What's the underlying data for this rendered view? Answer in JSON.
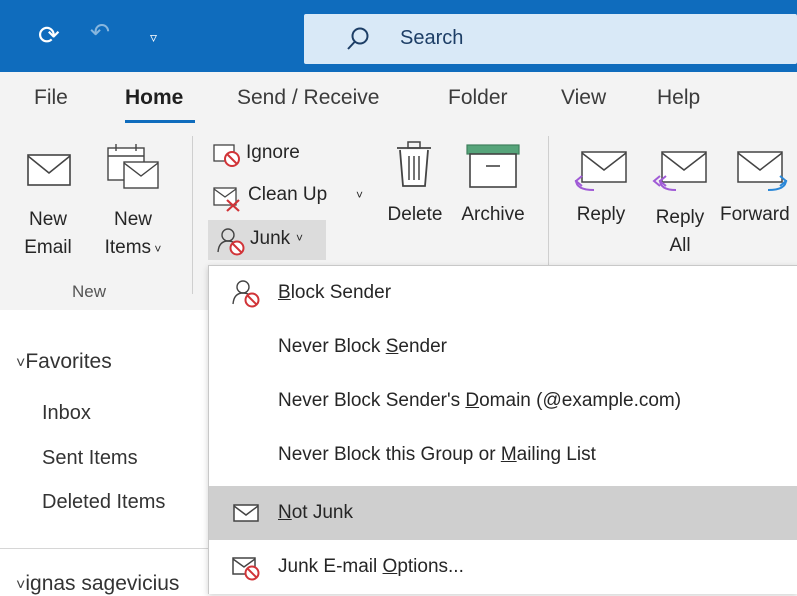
{
  "quick_access": {
    "search_placeholder": "Search"
  },
  "tabs": [
    "File",
    "Home",
    "Send / Receive",
    "Folder",
    "View",
    "Help"
  ],
  "ribbon": {
    "new_email": [
      "New",
      "Email"
    ],
    "new_items": [
      "New",
      "Items"
    ],
    "ignore": "Ignore",
    "clean_up": "Clean Up",
    "junk": "Junk",
    "delete": "Delete",
    "archive": "Archive",
    "reply": "Reply",
    "reply_all": [
      "Reply",
      "All"
    ],
    "forward": "Forward",
    "group_new": "New"
  },
  "folders": {
    "favorites_header": "Favorites",
    "items": [
      "Inbox",
      "Sent Items",
      "Deleted Items"
    ],
    "account": "ignas sagevicius"
  },
  "junk_menu": {
    "items": [
      {
        "pre": "",
        "u": "B",
        "post": "lock Sender",
        "icon": "block-sender-icon"
      },
      {
        "pre": "Never Block ",
        "u": "S",
        "post": "ender",
        "icon": ""
      },
      {
        "pre": "Never Block Sender's ",
        "u": "D",
        "post": "omain (@example.com)",
        "icon": ""
      },
      {
        "pre": "Never Block this Group or ",
        "u": "M",
        "post": "ailing List",
        "icon": ""
      },
      {
        "pre": "",
        "u": "N",
        "post": "ot Junk",
        "icon": "envelope-icon",
        "highlighted": true
      },
      {
        "pre": "Junk E-mail ",
        "u": "O",
        "post": "ptions...",
        "icon": "junk-options-icon"
      }
    ]
  },
  "colors": {
    "titlebar": "#0f6cbd",
    "search_bg": "#d9e9f7",
    "ribbon_bg": "#f3f3f3",
    "highlight": "#cfcfcf",
    "block_red": "#d13438",
    "reply_purple": "#a05bd6",
    "forward_blue": "#2b88d8",
    "archive_green": "#56a47a"
  }
}
